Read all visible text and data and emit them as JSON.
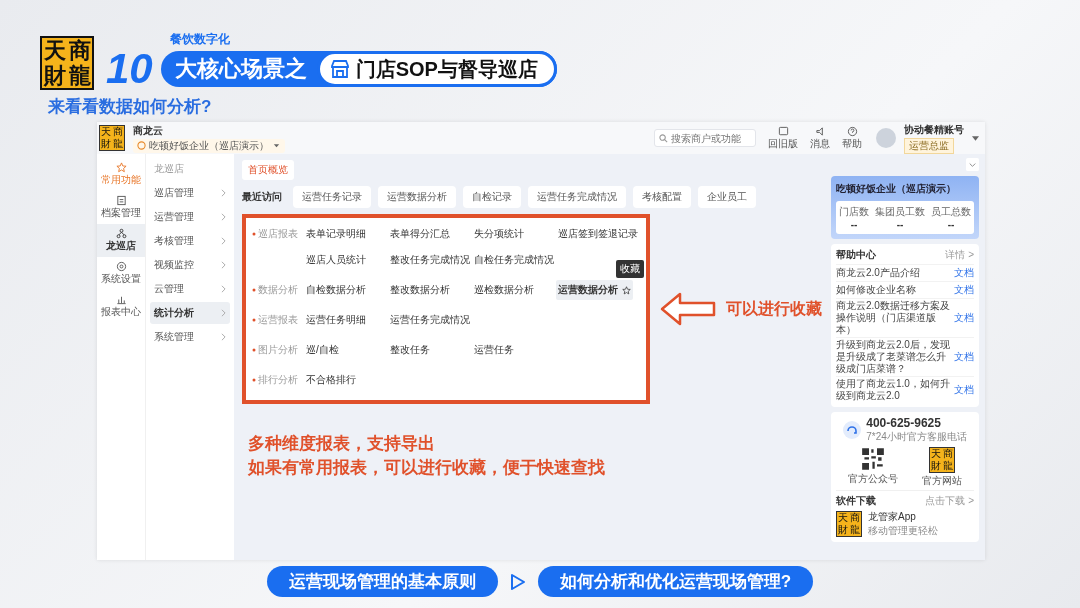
{
  "banner": {
    "logo": [
      "天",
      "商",
      "財",
      "龍"
    ],
    "kicker": "餐饮数字化",
    "number": "10",
    "title": "大核心场景之",
    "topic": "门店SOP与督导巡店"
  },
  "subtitle": "来看看数据如何分析?",
  "app": {
    "logo": [
      "天",
      "商",
      "財",
      "龍"
    ],
    "product": "商龙云",
    "company": "吃顿好饭企业（巡店演示）",
    "search": {
      "placeholder": "搜索商户或功能"
    },
    "toolbar": [
      {
        "label": "回旧版",
        "kind": "old"
      },
      {
        "label": "消息",
        "kind": "bell"
      },
      {
        "label": "帮助",
        "kind": "help"
      }
    ],
    "user": {
      "name": "协动餐精账号",
      "role": "运营总监"
    },
    "rail": [
      {
        "label": "常用功能",
        "kind": "star",
        "accent": true,
        "selected": false
      },
      {
        "label": "档案管理",
        "kind": "file",
        "accent": false,
        "selected": false
      },
      {
        "label": "龙巡店",
        "kind": "tree",
        "accent": false,
        "selected": true
      },
      {
        "label": "系统设置",
        "kind": "gear",
        "accent": false,
        "selected": false
      },
      {
        "label": "报表中心",
        "kind": "chart",
        "accent": false,
        "selected": false
      }
    ],
    "menu": {
      "title": "龙巡店",
      "items": [
        {
          "label": "巡店管理",
          "selected": false
        },
        {
          "label": "运营管理",
          "selected": false
        },
        {
          "label": "考核管理",
          "selected": false
        },
        {
          "label": "视频监控",
          "selected": false
        },
        {
          "label": "云管理",
          "selected": false
        },
        {
          "label": "统计分析",
          "selected": true
        },
        {
          "label": "系统管理",
          "selected": false
        }
      ]
    },
    "page_tab": "首页概览",
    "recent": {
      "label": "最近访问",
      "items": [
        "运营任务记录",
        "运营数据分析",
        "自检记录",
        "运营任务完成情况",
        "考核配置",
        "企业员工"
      ]
    },
    "report_groups": [
      {
        "name": "巡店报表",
        "items": [
          {
            "label": "表单记录明细",
            "hovered": false
          },
          {
            "label": "表单得分汇总",
            "hovered": false
          },
          {
            "label": "失分项统计",
            "hovered": false
          },
          {
            "label": "巡店签到签退记录",
            "hovered": false
          },
          {
            "label": "巡店人员统计",
            "hovered": false
          },
          {
            "label": "整改任务完成情况",
            "hovered": false
          },
          {
            "label": "自检任务完成情况",
            "hovered": false
          }
        ]
      },
      {
        "name": "数据分析",
        "items": [
          {
            "label": "自检数据分析",
            "hovered": false
          },
          {
            "label": "整改数据分析",
            "hovered": false
          },
          {
            "label": "巡检数据分析",
            "hovered": false
          },
          {
            "label": "运营数据分析",
            "hovered": true,
            "tooltip": "收藏"
          }
        ]
      },
      {
        "name": "运营报表",
        "items": [
          {
            "label": "运营任务明细",
            "hovered": false
          },
          {
            "label": "运营任务完成情况",
            "hovered": false
          }
        ]
      },
      {
        "name": "图片分析",
        "items": [
          {
            "label": "巡/自检",
            "hovered": false
          },
          {
            "label": "整改任务",
            "hovered": false
          },
          {
            "label": "运营任务",
            "hovered": false
          }
        ]
      },
      {
        "name": "排行分析",
        "items": [
          {
            "label": "不合格排行",
            "hovered": false
          }
        ]
      }
    ],
    "company_card": {
      "name": "吃顿好饭企业（巡店演示）",
      "stats": [
        {
          "label": "门店数",
          "value": "--"
        },
        {
          "label": "集团员工数",
          "value": "--"
        },
        {
          "label": "员工总数",
          "value": "--"
        }
      ]
    },
    "help": {
      "title": "帮助中心",
      "more": "详情 >",
      "items": [
        {
          "text": "商龙云2.0产品介绍",
          "link": "文档"
        },
        {
          "text": "如何修改企业名称",
          "link": "文档"
        },
        {
          "text": "商龙云2.0数据迁移方案及操作说明（门店渠道版本）",
          "link": "文档"
        },
        {
          "text": "升级到商龙云2.0后，发现是升级成了老菜谱怎么升级成门店菜谱？",
          "link": "文档"
        },
        {
          "text": "使用了商龙云1.0，如何升级到商龙云2.0",
          "link": "文档"
        }
      ]
    },
    "contact": {
      "phone": "400-625-9625",
      "note": "7*24小时官方客服电话",
      "qr_label": "官方公众号",
      "site_logo": [
        "天",
        "商",
        "財",
        "龍"
      ],
      "site_label": "官方网站"
    },
    "download": {
      "title": "软件下载",
      "more": "点击下载 >",
      "app_icon": [
        "天",
        "商",
        "財",
        "龍"
      ],
      "app_name": "龙管家App",
      "app_note": "移动管理更轻松"
    }
  },
  "annotations": {
    "callout": "可以进行收藏",
    "notes": [
      "多种维度报表，支持导出",
      "如果有常用报表，可以进行收藏，便于快速查找"
    ]
  },
  "footer": {
    "links": [
      "运营现场管理的基本原则",
      "如何分析和优化运营现场管理?"
    ]
  }
}
